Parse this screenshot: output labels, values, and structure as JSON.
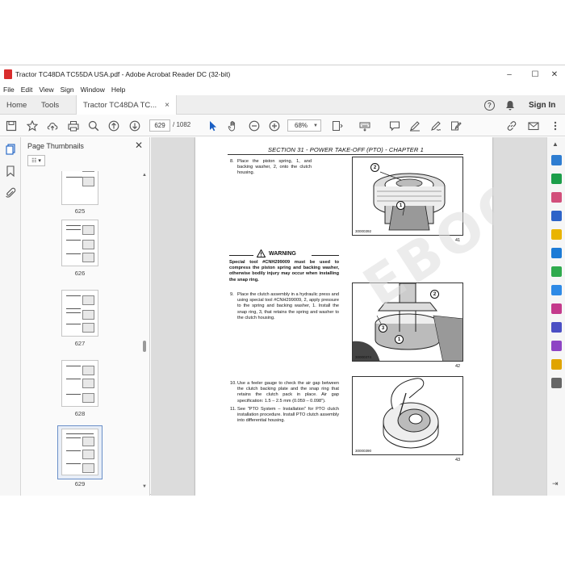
{
  "window": {
    "title": "Tractor TC48DA TC55DA USA.pdf - Adobe Acrobat Reader DC (32-bit)",
    "controls": {
      "minimize": "–",
      "maximize": "☐",
      "close": "✕"
    }
  },
  "menu": [
    "File",
    "Edit",
    "View",
    "Sign",
    "Window",
    "Help"
  ],
  "tabs": {
    "home": "Home",
    "tools": "Tools",
    "document": "Tractor TC48DA TC...",
    "close": "×"
  },
  "account": {
    "help": "?",
    "signin": "Sign In"
  },
  "toolbar": {
    "page_current": "629",
    "page_total": "/ 1082",
    "zoom": "68%"
  },
  "thumbnails": {
    "header": "Page Thumbnails",
    "close": "✕",
    "pages": [
      {
        "num": "625"
      },
      {
        "num": "626"
      },
      {
        "num": "627"
      },
      {
        "num": "628"
      },
      {
        "num": "629"
      }
    ],
    "selected": "629"
  },
  "document": {
    "page_header": "SECTION 31 - POWER TAKE-OFF (PTO) - CHAPTER 1",
    "steps": [
      {
        "n": "8.",
        "text": "Place the piston spring, 1, and backing washer, 2, onto the clutch housing."
      },
      {
        "n": "9.",
        "text": "Place the clutch assembly in a hydraulic press and using special tool #CNH299009, 2, apply pressure to the spring and backing washer, 1. Install the snap ring, 3, that retains the spring and washer to the clutch housing."
      },
      {
        "n": "10.",
        "text": "Use a feeler gauge to check the air gap between the clutch backing plate and the snap ring that retains the clutch pack in place. Air gap specification: 1.5 – 2.5 mm (0.059 – 0.098\")."
      },
      {
        "n": "11.",
        "text": "See \"PTO System – Installation\" for PTO clutch installation procedure. Install PTO clutch assembly into differential housing."
      }
    ],
    "warning": {
      "title": "WARNING",
      "body": "Special tool #CNH299009 must be used to compress the piston spring and backing washer, otherwise bodily injury may occur when installing the snap ring."
    },
    "figures": [
      {
        "code": "30000392",
        "num": "41",
        "callouts": [
          "2",
          "1"
        ]
      },
      {
        "code": "30000374",
        "num": "42",
        "callouts": [
          "2",
          "3",
          "1"
        ]
      },
      {
        "code": "30000390",
        "num": "43",
        "callouts": []
      }
    ],
    "watermark": "EBOOKERG.COM"
  },
  "colors": {
    "pdf_icon": "#d92c2c",
    "selection": "#6a8fc8",
    "doc_background": "#dcdcdc"
  }
}
